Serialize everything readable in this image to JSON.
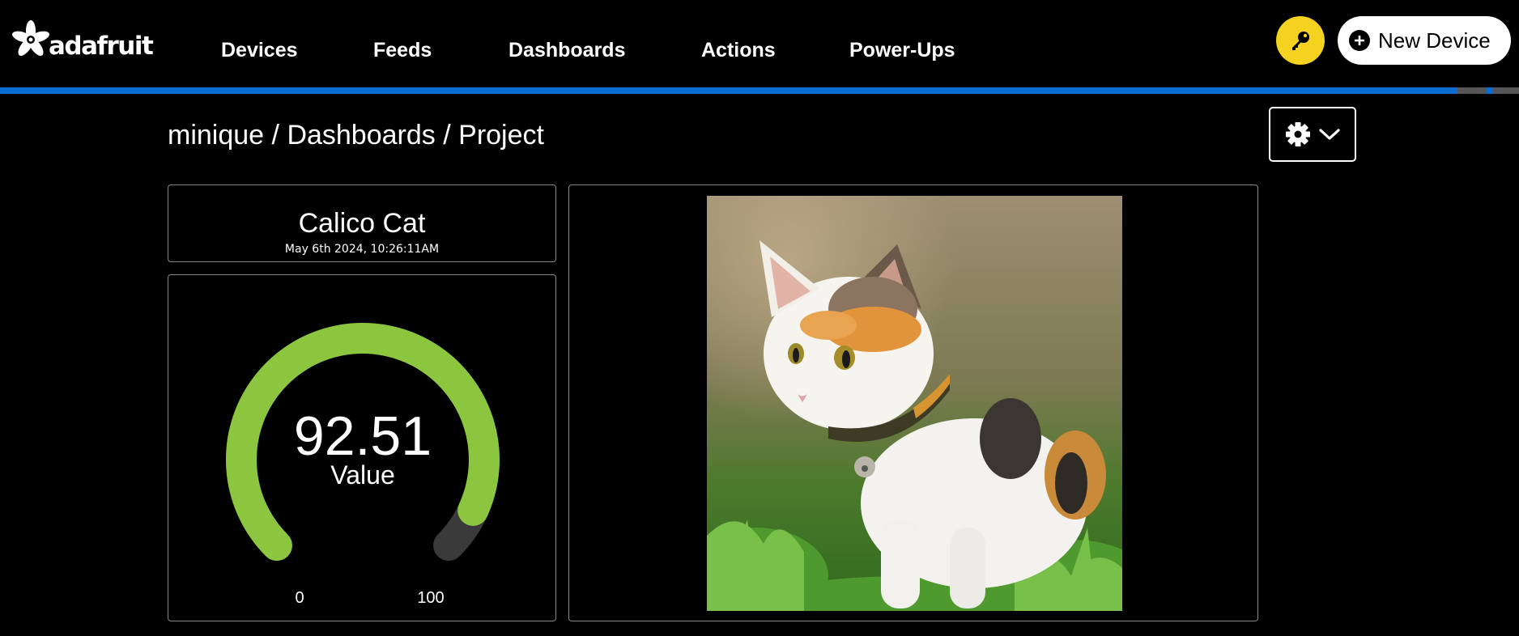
{
  "brand": {
    "name": "adafruit"
  },
  "nav": {
    "items": [
      {
        "label": "Devices"
      },
      {
        "label": "Feeds"
      },
      {
        "label": "Dashboards"
      },
      {
        "label": "Actions"
      },
      {
        "label": "Power-Ups"
      }
    ]
  },
  "header": {
    "key_icon": "key-icon",
    "new_device_label": "New Device",
    "new_device_icon": "plus-circle-icon"
  },
  "breadcrumb": {
    "user": "minique",
    "separator": "/",
    "section": "Dashboards",
    "page": "Project"
  },
  "settings": {
    "gear_icon": "gear-icon",
    "chevron_icon": "chevron-down-icon"
  },
  "blocks": {
    "text_block": {
      "title": "Calico Cat",
      "timestamp": "May 6th 2024, 10:26:11AM"
    },
    "gauge": {
      "value": 92.51,
      "value_text": "92.51",
      "label": "Value",
      "min": 0,
      "max": 100,
      "min_label": "0",
      "max_label": "100"
    },
    "image": {
      "subject": "calico-cat-photo"
    }
  },
  "colors": {
    "accent_blue": "#0a6bd1",
    "key_yellow": "#f5d21f",
    "gauge_green": "#8cc63f",
    "gauge_track": "#3a3a3a"
  }
}
